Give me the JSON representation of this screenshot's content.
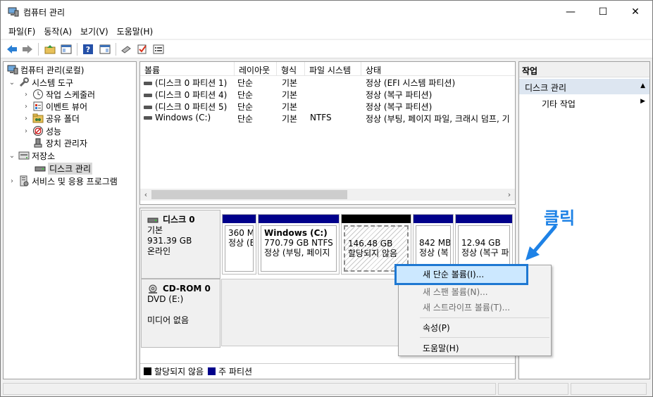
{
  "window": {
    "title": "컴퓨터 관리",
    "controls": {
      "minimize": "—",
      "maximize": "☐",
      "close": "✕"
    }
  },
  "menubar": [
    "파일(F)",
    "동작(A)",
    "보기(V)",
    "도움말(H)"
  ],
  "tree": {
    "root": "컴퓨터 관리(로컬)",
    "system_tools": "시스템 도구",
    "task_scheduler": "작업 스케줄러",
    "event_viewer": "이벤트 뷰어",
    "shared_folders": "공유 폴더",
    "performance": "성능",
    "device_manager": "장치 관리자",
    "storage": "저장소",
    "disk_management": "디스크 관리",
    "services": "서비스 및 응용 프로그램"
  },
  "volume_list": {
    "columns": [
      "볼륨",
      "레이아웃",
      "형식",
      "파일 시스템",
      "상태"
    ],
    "rows": [
      [
        "(디스크 0 파티션 1)",
        "단순",
        "기본",
        "",
        "정상 (EFI 시스템 파티션)"
      ],
      [
        "(디스크 0 파티션 4)",
        "단순",
        "기본",
        "",
        "정상 (복구 파티션)"
      ],
      [
        "(디스크 0 파티션 5)",
        "단순",
        "기본",
        "",
        "정상 (복구 파티션)"
      ],
      [
        "Windows (C:)",
        "단순",
        "기본",
        "NTFS",
        "정상 (부팅, 페이지 파일, 크래시 덤프, 기"
      ]
    ]
  },
  "disks": {
    "disk0": {
      "name": "디스크 0",
      "type": "기본",
      "size": "931.39 GB",
      "status": "온라인",
      "partitions": [
        {
          "line1": "360 M",
          "line2": "정상 (E"
        },
        {
          "title": "Windows  (C:)",
          "line1": "770.79 GB NTFS",
          "line2": "정상 (부팅, 페이지"
        },
        {
          "line1": "146.48 GB",
          "line2": "할당되지 않음"
        },
        {
          "line1": "842 MB",
          "line2": "정상 (복"
        },
        {
          "line1": "12.94 GB",
          "line2": "정상 (복구 파"
        }
      ]
    },
    "cdrom0": {
      "name": "CD-ROM 0",
      "drive": "DVD (E:)",
      "status": "미디어 없음"
    }
  },
  "legend": {
    "unallocated": "할당되지 않음",
    "primary": "주 파티션"
  },
  "actions": {
    "header": "작업",
    "section": "디스크 관리",
    "more": "기타 작업"
  },
  "context_menu": {
    "new_simple": "새 단순 볼륨(I)...",
    "new_spanned": "새 스팬 볼륨(N)...",
    "new_striped": "새 스트라이프 볼륨(T)...",
    "properties": "속성(P)",
    "help": "도움말(H)"
  },
  "annotation": {
    "label": "클릭"
  },
  "colors": {
    "primary_partition": "#00008b",
    "unallocated": "#000000",
    "highlight_border": "#1e78d2",
    "annotation": "#1e82e6"
  }
}
